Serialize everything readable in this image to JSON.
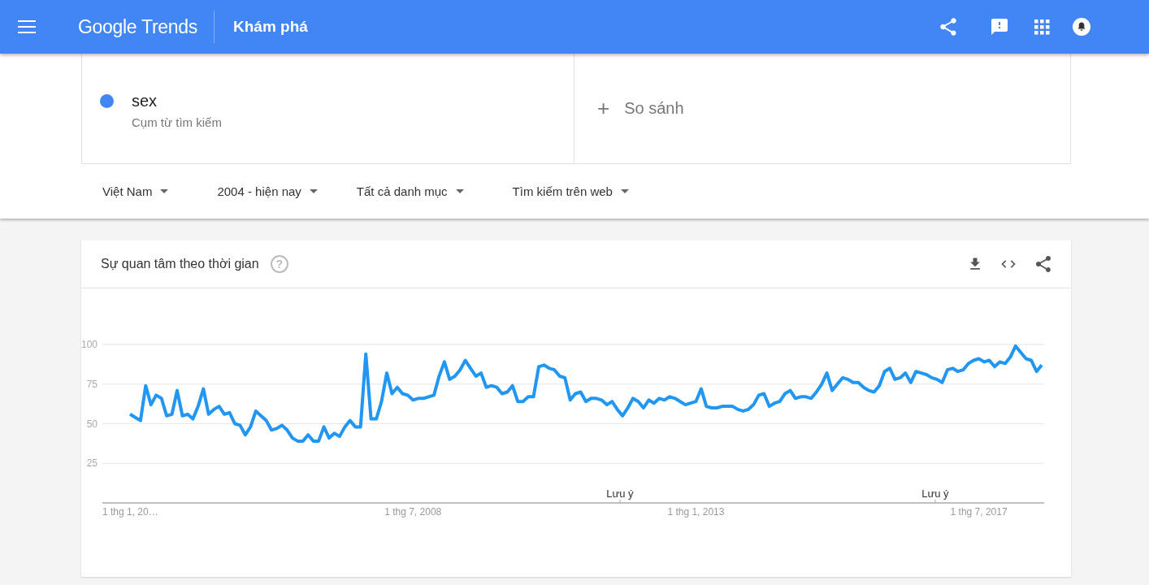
{
  "header": {
    "logo": "Google Trends",
    "title": "Khám phá"
  },
  "term": {
    "name": "sex",
    "subtitle": "Cụm từ tìm kiếm",
    "color": "#4285f4"
  },
  "compare": {
    "label": "So sánh",
    "icon": "+"
  },
  "filters": [
    {
      "label": "Việt Nam"
    },
    {
      "label": "2004 - hiện nay"
    },
    {
      "label": "Tất cả danh mục"
    },
    {
      "label": "Tìm kiếm trên web"
    }
  ],
  "card": {
    "title": "Sự quan tâm theo thời gian",
    "help": "?",
    "chart_data": {
      "type": "line",
      "grid": true,
      "ylim": [
        0,
        100
      ],
      "yticks": [
        25,
        50,
        75,
        100
      ],
      "categories": [
        "1 thg 1, 20…",
        null,
        null,
        null,
        null,
        null,
        null,
        null,
        null,
        null,
        null,
        null,
        null,
        null,
        null,
        null,
        null,
        null,
        null,
        null,
        null,
        null,
        null,
        null,
        null,
        null,
        null,
        null,
        null,
        null,
        null,
        null,
        null,
        null,
        null,
        null,
        null,
        null,
        null,
        null,
        null,
        null,
        null,
        null,
        null,
        null,
        null,
        null,
        null,
        null,
        null,
        null,
        null,
        null,
        "1 thg 7, 2008",
        null,
        null,
        null,
        null,
        null,
        null,
        null,
        null,
        null,
        null,
        null,
        null,
        null,
        null,
        null,
        null,
        null,
        null,
        null,
        null,
        null,
        null,
        null,
        null,
        null,
        null,
        null,
        null,
        null,
        null,
        null,
        null,
        null,
        null,
        null,
        null,
        null,
        null,
        null,
        null,
        null,
        null,
        null,
        null,
        null,
        null,
        null,
        null,
        null,
        null,
        null,
        null,
        null,
        "1 thg 1, 2013",
        null,
        null,
        null,
        null,
        null,
        null,
        null,
        null,
        null,
        null,
        null,
        null,
        null,
        null,
        null,
        null,
        null,
        null,
        null,
        null,
        null,
        null,
        null,
        null,
        null,
        null,
        null,
        null,
        null,
        null,
        null,
        null,
        null,
        null,
        null,
        null,
        null,
        null,
        null,
        null,
        null,
        null,
        null,
        null,
        null,
        null,
        null,
        null,
        null,
        null,
        null,
        null,
        null,
        "1 thg 7, 2017",
        null,
        null,
        null,
        null,
        null,
        null,
        null,
        null,
        null,
        null,
        null,
        null
      ],
      "annotations": [
        "Lưu ý",
        "Lưu ý"
      ],
      "series": [
        {
          "color": "#2196f3",
          "values": [
            56,
            54,
            52,
            74,
            62,
            68,
            66,
            55,
            56,
            71,
            55,
            56,
            53,
            61,
            72,
            56,
            59,
            61,
            56,
            57,
            50,
            49,
            43,
            48,
            58,
            55,
            52,
            46,
            47,
            49,
            46,
            41,
            39,
            39,
            43,
            39,
            39,
            48,
            41,
            44,
            42,
            48,
            52,
            48,
            48,
            94,
            53,
            53,
            64,
            82,
            69,
            73,
            69,
            68,
            65,
            66,
            66,
            67,
            68,
            80,
            89,
            78,
            80,
            84,
            90,
            85,
            80,
            82,
            73,
            74,
            73,
            69,
            70,
            74,
            64,
            64,
            67,
            67,
            86,
            87,
            85,
            84,
            80,
            79,
            65,
            69,
            70,
            64,
            66,
            66,
            65,
            62,
            64,
            59,
            55,
            60,
            66,
            64,
            60,
            65,
            63,
            66,
            65,
            67,
            66,
            64,
            62,
            63,
            64,
            72,
            61,
            60,
            60,
            61,
            61,
            61,
            59,
            58,
            59,
            62,
            68,
            69,
            61,
            63,
            64,
            69,
            71,
            66,
            67,
            67,
            66,
            70,
            75,
            82,
            71,
            75,
            79,
            78,
            76,
            76,
            73,
            71,
            70,
            74,
            83,
            85,
            78,
            79,
            82,
            76,
            83,
            82,
            81,
            79,
            78,
            76,
            84,
            85,
            83,
            84,
            88,
            90,
            91,
            89,
            90,
            86,
            89,
            88,
            92,
            99,
            95,
            91,
            90,
            83,
            87
          ]
        }
      ]
    }
  }
}
